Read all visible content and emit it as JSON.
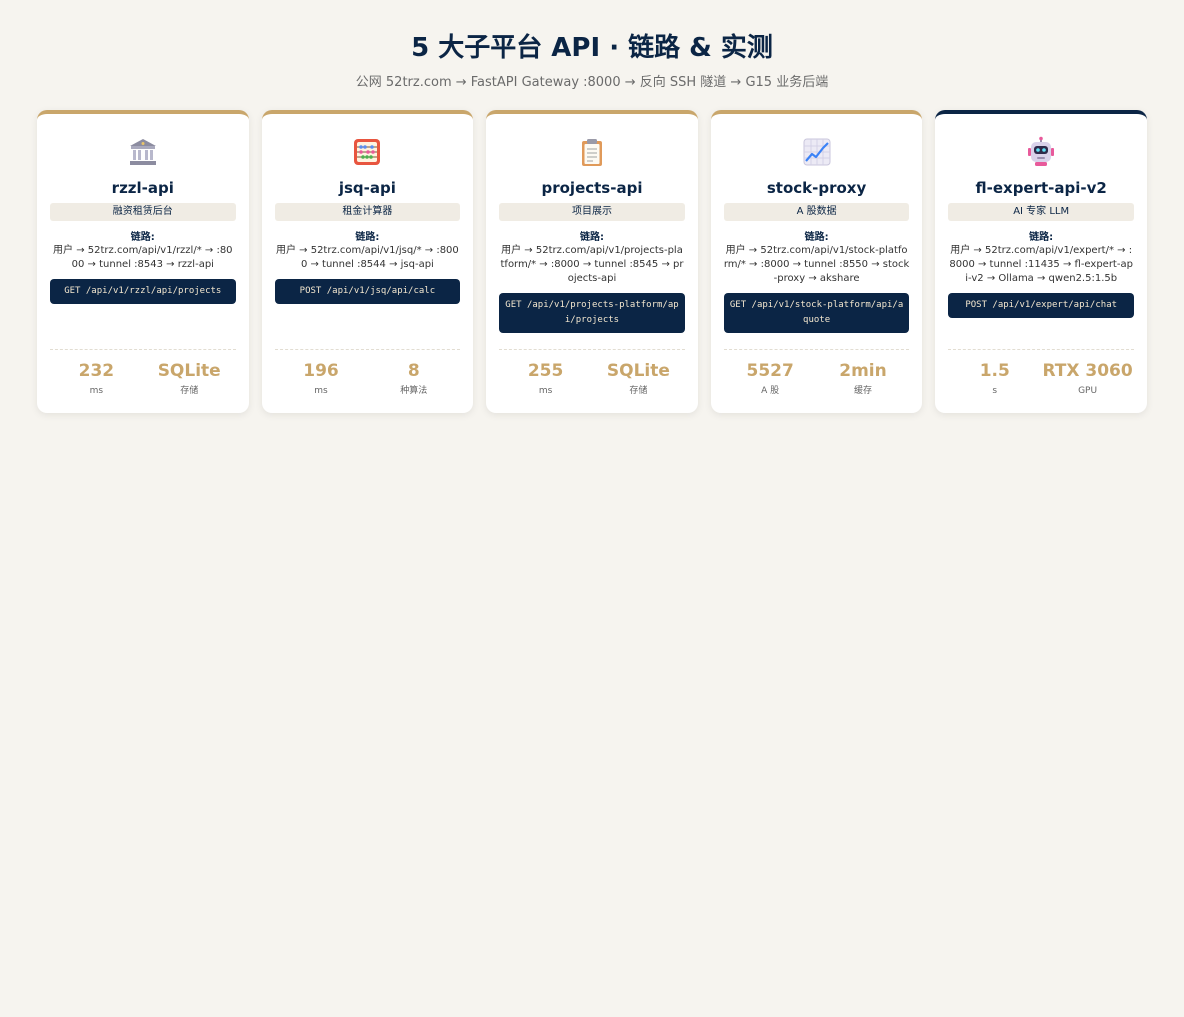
{
  "header": {
    "title": "5 大子平台 API · 链路 & 实测",
    "subtitle": "公网 52trz.com → FastAPI Gateway :8000 → 反向 SSH 隧道 → G15 业务后端"
  },
  "path_label": "链路:",
  "cards": [
    {
      "icon": "bank-icon",
      "name": "rzzl-api",
      "tag": "融资租赁后台",
      "path": "用户 → 52trz.com/api/v1/rzzl/* → :8000 → tunnel :8543 → rzzl-api",
      "endpoint": "GET /api/v1/rzzl/api/projects",
      "stat1_value": "232",
      "stat1_label": "ms",
      "stat2_value": "SQLite",
      "stat2_label": "存储"
    },
    {
      "icon": "abacus-icon",
      "name": "jsq-api",
      "tag": "租金计算器",
      "path": "用户 → 52trz.com/api/v1/jsq/* → :8000 → tunnel :8544 → jsq-api",
      "endpoint": "POST /api/v1/jsq/api/calc",
      "stat1_value": "196",
      "stat1_label": "ms",
      "stat2_value": "8",
      "stat2_label": "种算法"
    },
    {
      "icon": "clipboard-icon",
      "name": "projects-api",
      "tag": "项目展示",
      "path": "用户 → 52trz.com/api/v1/projects-platform/* → :8000 → tunnel :8545 → projects-api",
      "endpoint": "GET /api/v1/projects-platform/api/projects",
      "stat1_value": "255",
      "stat1_label": "ms",
      "stat2_value": "SQLite",
      "stat2_label": "存储"
    },
    {
      "icon": "chart-icon",
      "name": "stock-proxy",
      "tag": "A 股数据",
      "path": "用户 → 52trz.com/api/v1/stock-platform/* → :8000 → tunnel :8550 → stock-proxy → akshare",
      "endpoint": "GET /api/v1/stock-platform/api/aquote",
      "stat1_value": "5527",
      "stat1_label": "A 股",
      "stat2_value": "2min",
      "stat2_label": "缓存"
    },
    {
      "icon": "robot-icon",
      "name": "fl-expert-api-v2",
      "tag": "AI 专家 LLM",
      "path": "用户 → 52trz.com/api/v1/expert/* → :8000 → tunnel :11435 → fl-expert-api-v2 → Ollama → qwen2.5:1.5b",
      "endpoint": "POST /api/v1/expert/api/chat",
      "stat1_value": "1.5",
      "stat1_label": "s",
      "stat2_value": "RTX 3060",
      "stat2_label": "GPU"
    }
  ]
}
